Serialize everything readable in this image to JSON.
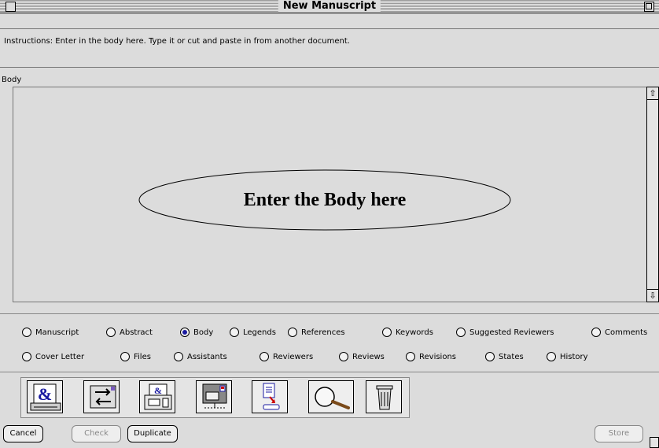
{
  "window": {
    "title": "New Manuscript"
  },
  "instructions": "Instructions: Enter in the body here. Type it or cut and paste in from another document.",
  "body_field": {
    "label": "Body",
    "hint": "Enter the Body here"
  },
  "sections_row1": [
    {
      "label": "Manuscript",
      "selected": false
    },
    {
      "label": "Abstract",
      "selected": false
    },
    {
      "label": "Body",
      "selected": true
    },
    {
      "label": "Legends",
      "selected": false
    },
    {
      "label": "References",
      "selected": false
    },
    {
      "label": "Keywords",
      "selected": false
    },
    {
      "label": "Suggested Reviewers",
      "selected": false
    },
    {
      "label": "Comments",
      "selected": false
    }
  ],
  "sections_row2": [
    {
      "label": "Cover Letter",
      "selected": false
    },
    {
      "label": "Files",
      "selected": false
    },
    {
      "label": "Assistants",
      "selected": false
    },
    {
      "label": "Reviewers",
      "selected": false
    },
    {
      "label": "Reviews",
      "selected": false
    },
    {
      "label": "Revisions",
      "selected": false
    },
    {
      "label": "States",
      "selected": false
    },
    {
      "label": "History",
      "selected": false
    }
  ],
  "toolbar_icons": [
    "print-ampersand-icon",
    "envelope-transfer-icon",
    "printer-fax-icon",
    "mail-terminal-icon",
    "document-export-icon",
    "magnifier-icon",
    "trash-icon"
  ],
  "buttons": {
    "cancel": "Cancel",
    "check": "Check",
    "duplicate": "Duplicate",
    "store": "Store"
  },
  "colors": {
    "selected_radio": "#1a1aa0",
    "window_bg": "#dcdcdc"
  }
}
